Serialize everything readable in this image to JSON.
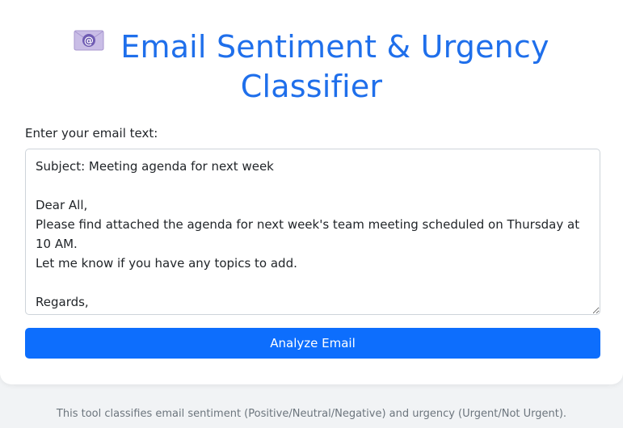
{
  "header": {
    "icon": "envelope-icon",
    "title": "Email Sentiment & Urgency Classifier"
  },
  "form": {
    "input_label": "Enter your email text:",
    "email_text": "Subject: Meeting agenda for next week\n\nDear All,\nPlease find attached the agenda for next week's team meeting scheduled on Thursday at 10 AM.\nLet me know if you have any topics to add.\n\nRegards,\nPriya",
    "analyze_button_label": "Analyze Email"
  },
  "footer": {
    "note": "This tool classifies email sentiment (Positive/Neutral/Negative) and urgency (Urgent/Not Urgent)."
  },
  "colors": {
    "accent": "#1f6feb",
    "button": "#0d6efd",
    "page_background": "#f1f3f5"
  }
}
